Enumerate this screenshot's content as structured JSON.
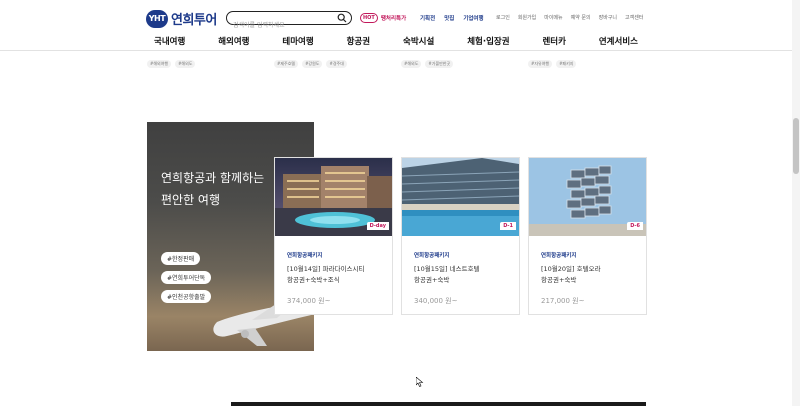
{
  "header": {
    "logo_badge": "YHT",
    "logo_text": "연희투어",
    "search_placeholder": "검색어를 입력하세요",
    "hot_badge": "HOT",
    "hot_text": "땡처리특가",
    "main_links": [
      "기획전",
      "맛집",
      "기업여행"
    ],
    "util_links": [
      "로그인",
      "회원가입",
      "마이메뉴",
      "예약 문의",
      "장바구니",
      "고객센터"
    ]
  },
  "gnb": [
    "국내여행",
    "해외여행",
    "테마여행",
    "항공권",
    "숙박시설",
    "체험·입장권",
    "렌터카",
    "연계서비스"
  ],
  "top_tags": [
    [
      "#해외여행",
      "#해외도"
    ],
    [
      "#제주호텔",
      "#강원도",
      "#경주대"
    ],
    [
      "#해외도",
      "#가볼만한곳"
    ],
    [
      "#자유여행",
      "#패키지"
    ]
  ],
  "promo": {
    "title_line1": "연희항공과 함께하는",
    "title_line2": "편안한 여행",
    "tags": [
      "#한정판매",
      "#연희투어단독",
      "#인천공항출발"
    ]
  },
  "cards": [
    {
      "badge": "D-day",
      "category": "연희항공패키지",
      "name_line1": "[10월14일] 파라다이스시티",
      "name_line2": "항공권+숙박+조식",
      "price": "374,000 원~"
    },
    {
      "badge": "D-1",
      "category": "연희항공패키지",
      "name_line1": "[10월15일] 네스트호텔",
      "name_line2": "항공권+숙박",
      "price": "340,000 원~"
    },
    {
      "badge": "D-6",
      "category": "연희항공패키지",
      "name_line1": "[10월20일] 호텔오라",
      "name_line2": "항공권+숙박",
      "price": "217,000 원~"
    }
  ],
  "colors": {
    "brand": "#1d3a8a",
    "accent": "#c2185b"
  }
}
